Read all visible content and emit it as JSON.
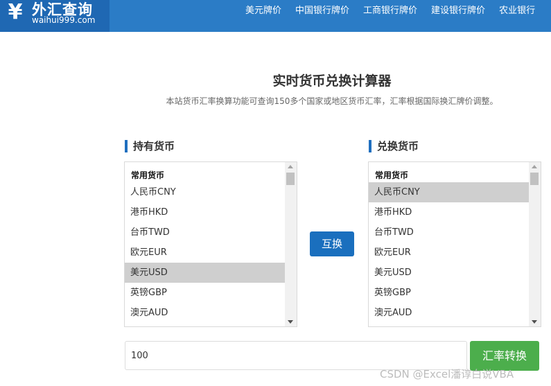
{
  "header": {
    "logo_icon": "yen-icon",
    "logo_title": "外汇查询",
    "logo_sub": "waihui999.com",
    "nav": [
      "美元牌价",
      "中国银行牌价",
      "工商银行牌价",
      "建设银行牌价",
      "农业银行"
    ]
  },
  "main": {
    "title": "实时货币兑换计算器",
    "subtitle": "本站货币汇率换算功能可查询150多个国家或地区货币汇率，汇率根据国际换汇牌价调整。"
  },
  "from_panel": {
    "heading": "持有货币",
    "group_label": "常用货币",
    "options": [
      "人民币CNY",
      "港币HKD",
      "台币TWD",
      "欧元EUR",
      "美元USD",
      "英镑GBP",
      "澳元AUD"
    ],
    "selected": "美元USD"
  },
  "to_panel": {
    "heading": "兑换货币",
    "group_label": "常用货币",
    "options": [
      "人民币CNY",
      "港币HKD",
      "台币TWD",
      "欧元EUR",
      "美元USD",
      "英镑GBP",
      "澳元AUD"
    ],
    "selected": "人民币CNY"
  },
  "swap_label": "互换",
  "amount": {
    "value": "100"
  },
  "convert_label": "汇率转换",
  "watermark": "CSDN @Excel潘谆白说VBA",
  "colors": {
    "header": "#2b7cc6",
    "swap_button": "#1a6fbe",
    "convert_button": "#4cae4c",
    "selection": "#cfcfcf"
  }
}
